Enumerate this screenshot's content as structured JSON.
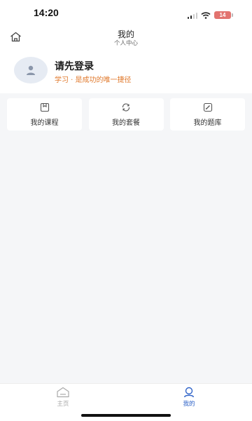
{
  "status_bar": {
    "time": "14:20",
    "battery": "14",
    "icons": [
      "signal-icon",
      "wifi-icon",
      "battery-icon"
    ]
  },
  "header": {
    "title": "我的",
    "subtitle": "个人中心",
    "home_icon": "home-icon"
  },
  "profile": {
    "title": "请先登录",
    "slogan": "学习 · 是成功的唯一捷径",
    "avatar_icon": "user-icon"
  },
  "cards": [
    {
      "label": "我的课程",
      "icon": "bookmark-icon"
    },
    {
      "label": "我的套餐",
      "icon": "refresh-icon"
    },
    {
      "label": "我的题库",
      "icon": "edit-icon"
    }
  ],
  "tabbar": {
    "items": [
      {
        "label": "主页",
        "icon": "home-icon",
        "active": false
      },
      {
        "label": "我的",
        "icon": "profile-icon",
        "active": true
      }
    ]
  },
  "colors": {
    "accent": "#2f63c8",
    "slogan": "#e07a2e",
    "background": "#f5f6f8",
    "avatar_bg": "#e6ebf3"
  }
}
